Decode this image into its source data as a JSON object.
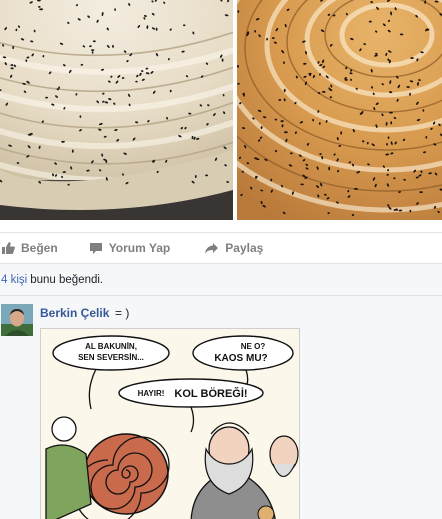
{
  "post": {
    "photos": [
      {
        "name": "rolled-borek-photo-left"
      },
      {
        "name": "rolled-borek-photo-right"
      }
    ]
  },
  "actions": {
    "like_label": "Beğen",
    "comment_label": "Yorum Yap",
    "share_label": "Paylaş",
    "icons": [
      "thumbs-up-icon",
      "comment-icon",
      "share-arrow-icon"
    ]
  },
  "likes": {
    "count": "4 kişi",
    "text": "bunu beğendi."
  },
  "comment": {
    "author": "Berkin Çelik",
    "text": "= )",
    "cartoon": {
      "bubble_1": "AL BAKUNİN, SEN SEVERSİN...",
      "bubble_2_line1": "NE O?",
      "bubble_2_line2": "KAOS MU?",
      "bubble_3_prefix": "HAYIR!",
      "bubble_3_bold": "KOL BÖREĞİ!"
    }
  },
  "colors": {
    "link_blue": "#4267b2",
    "author_blue": "#365899",
    "action_gray": "#7f7f7f",
    "strip_bg": "#f6f7f9"
  }
}
